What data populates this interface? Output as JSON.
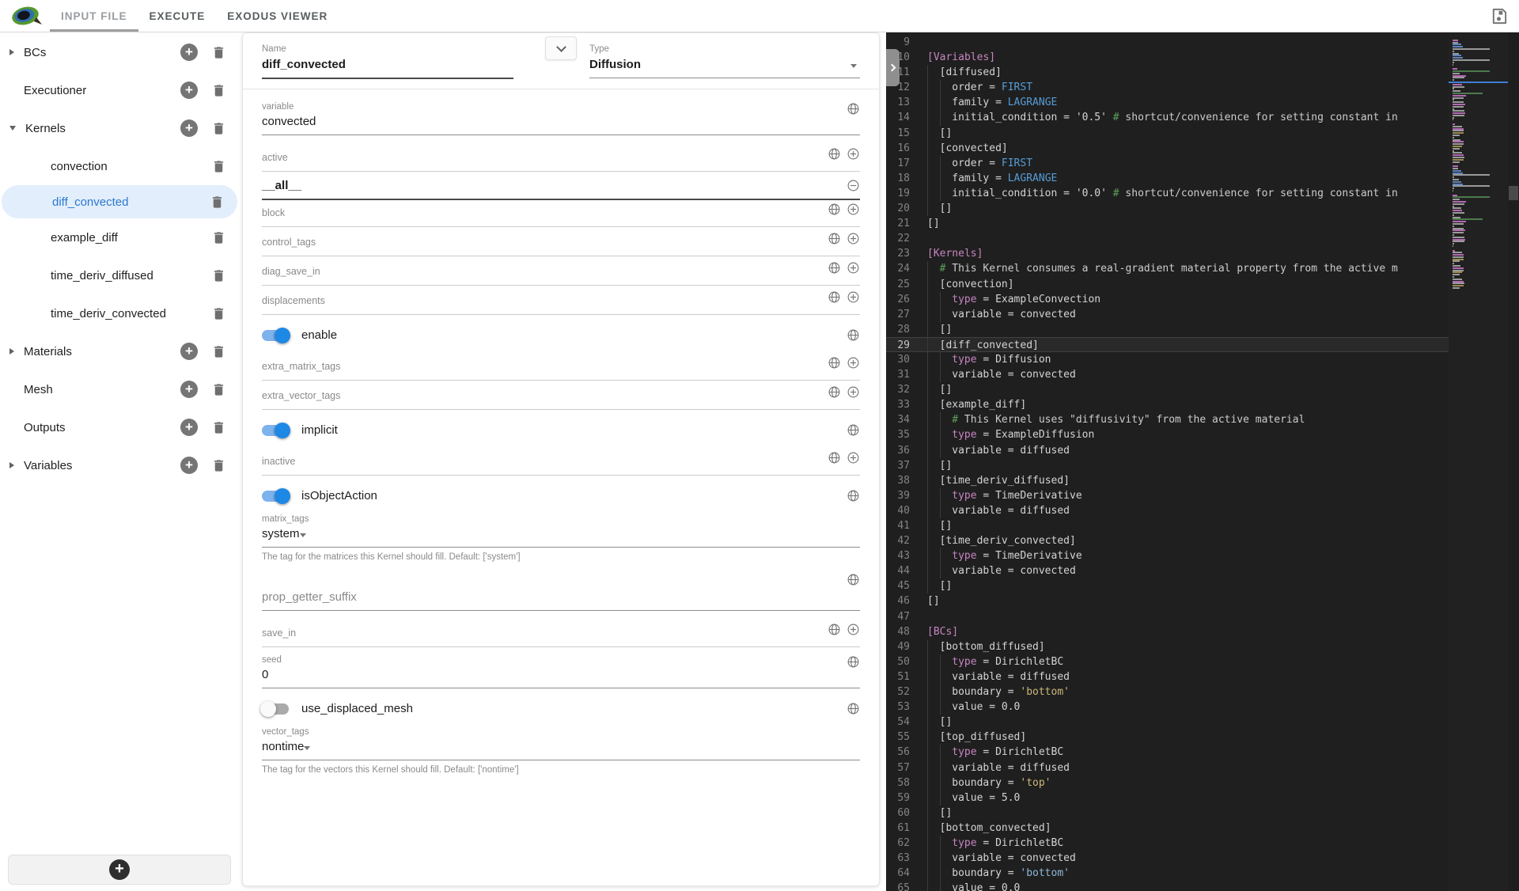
{
  "topbar": {
    "tabs": [
      {
        "label": "INPUT FILE",
        "active": true
      },
      {
        "label": "EXECUTE",
        "active": false
      },
      {
        "label": "EXODUS VIEWER",
        "active": false
      }
    ],
    "icons": [
      "moose-logo",
      "save-icon"
    ]
  },
  "sidebar": {
    "add_button": "+",
    "items": [
      {
        "label": "BCs",
        "expandable": true
      },
      {
        "label": "Executioner"
      },
      {
        "label": "Kernels",
        "expanded": true,
        "children": [
          {
            "label": "convection"
          },
          {
            "label": "diff_convected",
            "selected": true
          },
          {
            "label": "example_diff"
          },
          {
            "label": "time_deriv_diffused"
          },
          {
            "label": "time_deriv_convected"
          }
        ]
      },
      {
        "label": "Materials",
        "expandable": true
      },
      {
        "label": "Mesh"
      },
      {
        "label": "Outputs"
      },
      {
        "label": "Variables",
        "expandable": true
      }
    ]
  },
  "form": {
    "name": {
      "label": "Name",
      "value": "diff_convected"
    },
    "type": {
      "label": "Type",
      "value": "Diffusion"
    },
    "fields": [
      {
        "kind": "text",
        "label": "variable",
        "value": "convected"
      },
      {
        "kind": "list",
        "label": "active",
        "value": "__all__"
      },
      {
        "kind": "list-empty",
        "label": "block"
      },
      {
        "kind": "list-empty",
        "label": "control_tags"
      },
      {
        "kind": "list-empty",
        "label": "diag_save_in"
      },
      {
        "kind": "list-empty",
        "label": "displacements"
      },
      {
        "kind": "toggle",
        "label": "enable",
        "on": true
      },
      {
        "kind": "list-empty",
        "label": "extra_matrix_tags"
      },
      {
        "kind": "list-empty",
        "label": "extra_vector_tags"
      },
      {
        "kind": "toggle",
        "label": "implicit",
        "on": true
      },
      {
        "kind": "list-empty",
        "label": "inactive"
      },
      {
        "kind": "toggle",
        "label": "isObjectAction",
        "on": true
      },
      {
        "kind": "select",
        "label": "matrix_tags",
        "value": "system",
        "helper": "The tag for the matrices this Kernel should fill. Default: ['system']"
      },
      {
        "kind": "text-empty",
        "label": "prop_getter_suffix"
      },
      {
        "kind": "list-empty",
        "label": "save_in"
      },
      {
        "kind": "text",
        "label": "seed",
        "value": "0"
      },
      {
        "kind": "toggle",
        "label": "use_displaced_mesh",
        "on": false
      },
      {
        "kind": "select",
        "label": "vector_tags",
        "value": "nontime",
        "helper": "The tag for the vectors this Kernel should fill. Default: ['nontime']"
      }
    ]
  },
  "editor": {
    "colors": {
      "d": "#d4d4d4",
      "b": "#c586c0",
      "e": "#569cd6",
      "s": "#cdb87b",
      "s2": "#8fb8d8",
      "ch": "#5aa05a",
      "c": "#cccccc"
    },
    "lines": [
      {
        "n": 9,
        "i": 0,
        "s": []
      },
      {
        "n": 10,
        "i": 0,
        "s": [
          {
            "t": "[Variables]",
            "c": "b"
          }
        ]
      },
      {
        "n": 11,
        "i": 1,
        "s": [
          {
            "t": "[diffused]"
          }
        ]
      },
      {
        "n": 12,
        "i": 2,
        "s": [
          {
            "t": "order = "
          },
          {
            "t": "FIRST",
            "c": "e"
          }
        ]
      },
      {
        "n": 13,
        "i": 2,
        "s": [
          {
            "t": "family = "
          },
          {
            "t": "LAGRANGE",
            "c": "e"
          }
        ]
      },
      {
        "n": 14,
        "i": 2,
        "s": [
          {
            "t": "initial_condition = '0.5' "
          },
          {
            "t": "#",
            "c": "ch"
          },
          {
            "t": " shortcut/convenience for setting constant in",
            "c": "c"
          }
        ]
      },
      {
        "n": 15,
        "i": 1,
        "s": [
          {
            "t": "[]"
          }
        ]
      },
      {
        "n": 16,
        "i": 1,
        "s": [
          {
            "t": "[convected]"
          }
        ]
      },
      {
        "n": 17,
        "i": 2,
        "s": [
          {
            "t": "order = "
          },
          {
            "t": "FIRST",
            "c": "e"
          }
        ]
      },
      {
        "n": 18,
        "i": 2,
        "s": [
          {
            "t": "family = "
          },
          {
            "t": "LAGRANGE",
            "c": "e"
          }
        ]
      },
      {
        "n": 19,
        "i": 2,
        "s": [
          {
            "t": "initial_condition = '0.0' "
          },
          {
            "t": "#",
            "c": "ch"
          },
          {
            "t": " shortcut/convenience for setting constant in",
            "c": "c"
          }
        ]
      },
      {
        "n": 20,
        "i": 1,
        "s": [
          {
            "t": "[]"
          }
        ]
      },
      {
        "n": 21,
        "i": 0,
        "s": [
          {
            "t": "[]"
          }
        ]
      },
      {
        "n": 22,
        "i": 0,
        "s": []
      },
      {
        "n": 23,
        "i": 0,
        "s": [
          {
            "t": "[Kernels]",
            "c": "b"
          }
        ]
      },
      {
        "n": 24,
        "i": 1,
        "s": [
          {
            "t": "#",
            "c": "ch"
          },
          {
            "t": " This Kernel consumes a real-gradient material property from the active m",
            "c": "c"
          }
        ]
      },
      {
        "n": 25,
        "i": 1,
        "s": [
          {
            "t": "[convection]"
          }
        ]
      },
      {
        "n": 26,
        "i": 2,
        "s": [
          {
            "t": "type",
            "c": "b"
          },
          {
            "t": " = ExampleConvection"
          }
        ]
      },
      {
        "n": 27,
        "i": 2,
        "s": [
          {
            "t": "variable = convected"
          }
        ]
      },
      {
        "n": 28,
        "i": 1,
        "s": [
          {
            "t": "[]"
          }
        ]
      },
      {
        "n": 29,
        "i": 1,
        "cur": true,
        "s": [
          {
            "t": "[diff_convected]"
          }
        ]
      },
      {
        "n": 30,
        "i": 2,
        "s": [
          {
            "t": "type",
            "c": "b"
          },
          {
            "t": " = Diffusion"
          }
        ]
      },
      {
        "n": 31,
        "i": 2,
        "s": [
          {
            "t": "variable = convected"
          }
        ]
      },
      {
        "n": 32,
        "i": 1,
        "s": [
          {
            "t": "[]"
          }
        ]
      },
      {
        "n": 33,
        "i": 1,
        "s": [
          {
            "t": "[example_diff]"
          }
        ]
      },
      {
        "n": 34,
        "i": 2,
        "s": [
          {
            "t": "#",
            "c": "ch"
          },
          {
            "t": " This Kernel uses \"diffusivity\" from the active material",
            "c": "c"
          }
        ]
      },
      {
        "n": 35,
        "i": 2,
        "s": [
          {
            "t": "type",
            "c": "b"
          },
          {
            "t": " = ExampleDiffusion"
          }
        ]
      },
      {
        "n": 36,
        "i": 2,
        "s": [
          {
            "t": "variable = diffused"
          }
        ]
      },
      {
        "n": 37,
        "i": 1,
        "s": [
          {
            "t": "[]"
          }
        ]
      },
      {
        "n": 38,
        "i": 1,
        "s": [
          {
            "t": "[time_deriv_diffused]"
          }
        ]
      },
      {
        "n": 39,
        "i": 2,
        "s": [
          {
            "t": "type",
            "c": "b"
          },
          {
            "t": " = TimeDerivative"
          }
        ]
      },
      {
        "n": 40,
        "i": 2,
        "s": [
          {
            "t": "variable = diffused"
          }
        ]
      },
      {
        "n": 41,
        "i": 1,
        "s": [
          {
            "t": "[]"
          }
        ]
      },
      {
        "n": 42,
        "i": 1,
        "s": [
          {
            "t": "[time_deriv_convected]"
          }
        ]
      },
      {
        "n": 43,
        "i": 2,
        "s": [
          {
            "t": "type",
            "c": "b"
          },
          {
            "t": " = TimeDerivative"
          }
        ]
      },
      {
        "n": 44,
        "i": 2,
        "s": [
          {
            "t": "variable = convected"
          }
        ]
      },
      {
        "n": 45,
        "i": 1,
        "s": [
          {
            "t": "[]"
          }
        ]
      },
      {
        "n": 46,
        "i": 0,
        "s": [
          {
            "t": "[]"
          }
        ]
      },
      {
        "n": 47,
        "i": 0,
        "s": []
      },
      {
        "n": 48,
        "i": 0,
        "s": [
          {
            "t": "[BCs]",
            "c": "b"
          }
        ]
      },
      {
        "n": 49,
        "i": 1,
        "s": [
          {
            "t": "[bottom_diffused]"
          }
        ]
      },
      {
        "n": 50,
        "i": 2,
        "s": [
          {
            "t": "type",
            "c": "b"
          },
          {
            "t": " = DirichletBC"
          }
        ]
      },
      {
        "n": 51,
        "i": 2,
        "s": [
          {
            "t": "variable = diffused"
          }
        ]
      },
      {
        "n": 52,
        "i": 2,
        "s": [
          {
            "t": "boundary = "
          },
          {
            "t": "'bottom'",
            "c": "s"
          }
        ]
      },
      {
        "n": 53,
        "i": 2,
        "s": [
          {
            "t": "value = 0.0"
          }
        ]
      },
      {
        "n": 54,
        "i": 1,
        "s": [
          {
            "t": "[]"
          }
        ]
      },
      {
        "n": 55,
        "i": 1,
        "s": [
          {
            "t": "[top_diffused]"
          }
        ]
      },
      {
        "n": 56,
        "i": 2,
        "s": [
          {
            "t": "type",
            "c": "b"
          },
          {
            "t": " = DirichletBC"
          }
        ]
      },
      {
        "n": 57,
        "i": 2,
        "s": [
          {
            "t": "variable = diffused"
          }
        ]
      },
      {
        "n": 58,
        "i": 2,
        "s": [
          {
            "t": "boundary = "
          },
          {
            "t": "'top'",
            "c": "s"
          }
        ]
      },
      {
        "n": 59,
        "i": 2,
        "s": [
          {
            "t": "value = 5.0"
          }
        ]
      },
      {
        "n": 60,
        "i": 1,
        "s": [
          {
            "t": "[]"
          }
        ]
      },
      {
        "n": 61,
        "i": 1,
        "s": [
          {
            "t": "[bottom_convected]"
          }
        ]
      },
      {
        "n": 62,
        "i": 2,
        "s": [
          {
            "t": "type",
            "c": "b"
          },
          {
            "t": " = DirichletBC"
          }
        ]
      },
      {
        "n": 63,
        "i": 2,
        "s": [
          {
            "t": "variable = convected"
          }
        ]
      },
      {
        "n": 64,
        "i": 2,
        "s": [
          {
            "t": "boundary = "
          },
          {
            "t": "'bottom'",
            "c": "s2"
          }
        ]
      },
      {
        "n": 65,
        "i": 2,
        "s": [
          {
            "t": "value = 0.0"
          }
        ]
      }
    ]
  }
}
